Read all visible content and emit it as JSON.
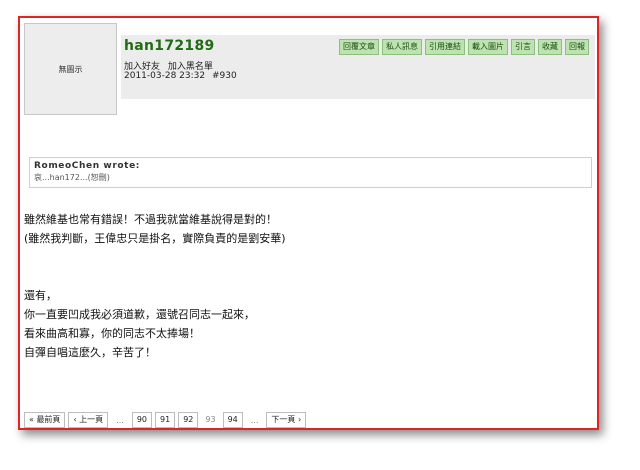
{
  "avatar": {
    "label": "無圖示"
  },
  "post": {
    "username": "han172189",
    "links": [
      "加入好友",
      "加入黑名單"
    ],
    "date": "2011-03-28 23:32",
    "number": "#930",
    "actions": [
      "回覆文章",
      "私人訊息",
      "引用連結",
      "載入圖片",
      "引言",
      "收藏",
      "回報"
    ]
  },
  "quote": {
    "author": "RomeoChen wrote:",
    "text": "哀...han172...(恕刪)"
  },
  "body": {
    "lines_a": [
      "雖然維基也常有錯誤！不過我就當維基說得是對的！",
      "(雖然我判斷，王偉忠只是掛名，實際負責的是劉安華)"
    ],
    "lines_b": [
      "還有，",
      "你一直要凹成我必須道歉，還號召同志一起來，",
      "看來曲高和寡，你的同志不太捧場！",
      "自彈自唱這麼久，辛苦了！"
    ]
  },
  "pager": {
    "first": "« 最前頁",
    "prev": "‹ 上一頁",
    "ellipsis": "...",
    "pages": [
      "90",
      "91",
      "92",
      "93",
      "94"
    ],
    "current": "93",
    "next": "下一頁 ›"
  }
}
